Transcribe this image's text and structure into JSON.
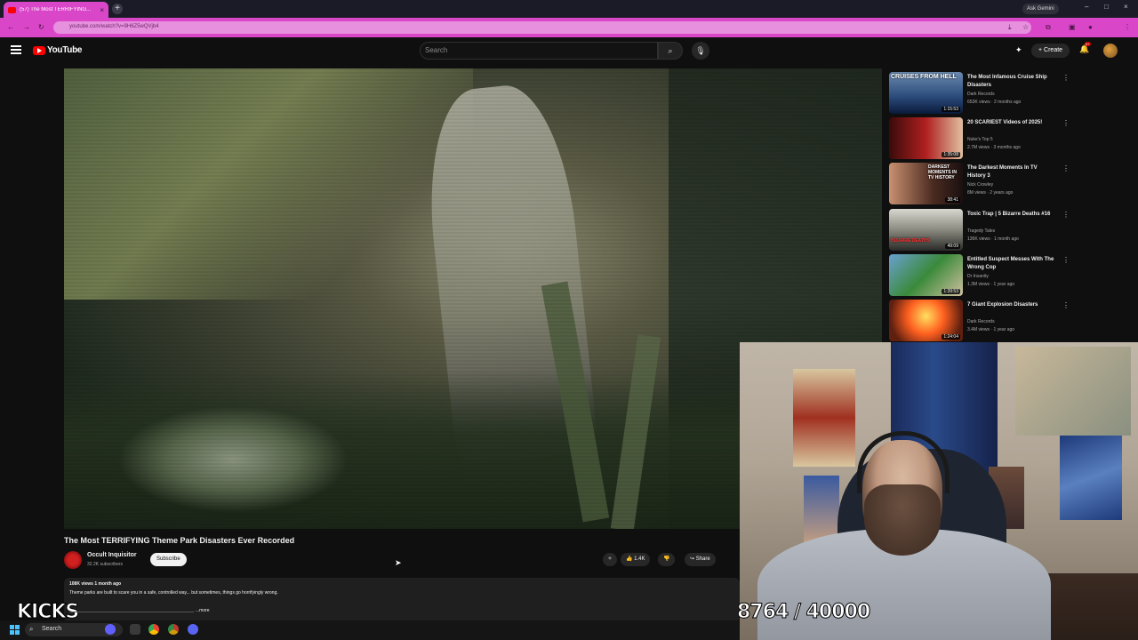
{
  "browser": {
    "tab_title": "(57) The Most TERRIFYING...",
    "tab_close": "×",
    "new_tab": "+",
    "ask_gemini": "Ask Gemini",
    "url": "youtube.com/watch?v=9H6Z5wQVjb4",
    "window_controls": [
      "–",
      "□",
      "×"
    ]
  },
  "youtube": {
    "logo_text": "YouTube",
    "search_placeholder": "Search",
    "create_label": "Create",
    "notification_badge": "9+"
  },
  "video": {
    "title": "The Most TERRIFYING Theme Park Disasters Ever Recorded",
    "channel_name": "Occult Inquisitor",
    "channel_subs": "32.2K subscribers",
    "subscribe_label": "Subscribe",
    "likes": "1.4K",
    "share_label": "Share",
    "meta": "108K views  1 month ago",
    "description": "Theme parks are built to scare you in a safe, controlled way... but sometimes, things go horrifyingly wrong.",
    "more_label": "...more"
  },
  "recommendations": [
    {
      "title": "The Most Infamous Cruise Ship Disasters",
      "channel": "Dark Records",
      "meta": "653K views · 2 months ago",
      "duration": "1:15:53",
      "thumb_text": "CRUISES FROM HELL"
    },
    {
      "title": "20 SCARIEST Videos of 2025!",
      "channel": "Nuke's Top 5",
      "meta": "2.7M views · 3 months ago",
      "duration": "1:35:08",
      "thumb_text": ""
    },
    {
      "title": "The Darkest Moments In TV History 3",
      "channel": "Nick Crowley",
      "meta": "8M views · 2 years ago",
      "duration": "38:41",
      "thumb_text": "DARKEST MOMENTS IN TV HISTORY"
    },
    {
      "title": "Toxic Trap | 5 Bizarre Deaths #16",
      "channel": "Tragedy Tales",
      "meta": "136K views · 1 month ago",
      "duration": "49:09",
      "thumb_text": "BIZARRE DEATHS"
    },
    {
      "title": "Entitled Suspect Messes With The Wrong Cop",
      "channel": "Dr Insanity",
      "meta": "1.3M views · 1 year ago",
      "duration": "1:39:53",
      "thumb_text": ""
    },
    {
      "title": "7 Giant Explosion Disasters",
      "channel": "Dark Records",
      "meta": "3.4M views · 1 year ago",
      "duration": "1:24:04",
      "thumb_text": ""
    }
  ],
  "overlay": {
    "kicks_label": "KICKS",
    "counter": "8764 / 40000"
  },
  "taskbar": {
    "search_label": "Search"
  },
  "colors": {
    "browser_accent": "#d946c8",
    "youtube_red": "#ff0000",
    "background": "#0f0f0f"
  }
}
